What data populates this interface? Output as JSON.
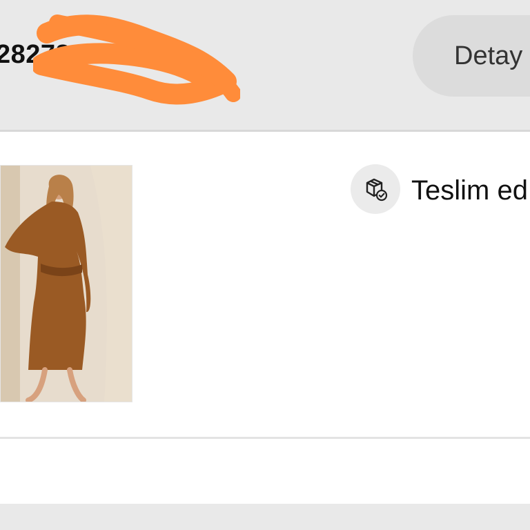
{
  "order": {
    "number_visible": "28278         154",
    "detail_label": "Detay"
  },
  "item": {
    "status_icon": "package-check-icon",
    "status_text": "Teslim ed",
    "image_description_icon": "product-photo"
  },
  "colors": {
    "header_bg": "#e9e9e9",
    "card_bg": "#ffffff",
    "redaction": "#ff8c3a",
    "dress": "#9a5a24"
  }
}
